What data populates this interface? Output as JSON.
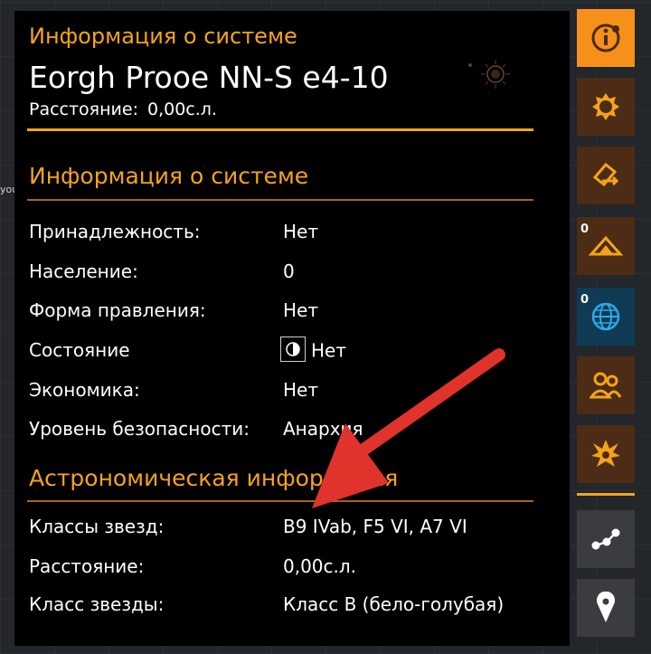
{
  "background_text": "you",
  "header": {
    "subtitle": "Информация о системе",
    "title": "Eorgh Prooe NN-S e4-10",
    "distance_label": "Расстояние:",
    "distance_value": "0,00с.л."
  },
  "system_info": {
    "title": "Информация о системе",
    "rows": [
      {
        "label": "Принадлежность:",
        "value": "Нет"
      },
      {
        "label": "Население:",
        "value": "0"
      },
      {
        "label": "Форма правления:",
        "value": "Нет"
      },
      {
        "label": "Состояние",
        "value": "Нет",
        "icon": "contrast-icon"
      },
      {
        "label": "Экономика:",
        "value": "Нет"
      },
      {
        "label": "Уровень безопасности:",
        "value": "Анархия"
      }
    ]
  },
  "astro_info": {
    "title": "Астрономическая информация",
    "rows": [
      {
        "label": "Классы звезд:",
        "value": "B9 IVab, F5 VI, A7 VI"
      },
      {
        "label": "Расстояние:",
        "value": "0,00с.л."
      },
      {
        "label": "Класс звезды:",
        "value": "Класс B (бело-голубая)"
      }
    ]
  },
  "sidebar": {
    "buttons": [
      {
        "name": "info-icon",
        "active": true
      },
      {
        "name": "star-icon"
      },
      {
        "name": "route-icon"
      },
      {
        "name": "planet-icon",
        "count": "0"
      },
      {
        "name": "globe-icon",
        "count": "0",
        "selected": true
      },
      {
        "name": "people-icon"
      },
      {
        "name": "explosion-icon"
      },
      {
        "name": "nodes-icon"
      },
      {
        "name": "location-pin-icon"
      }
    ]
  },
  "colors": {
    "accent": "#f6a31a",
    "panel_bg": "#000000",
    "annotation_arrow": "#e0332b"
  }
}
